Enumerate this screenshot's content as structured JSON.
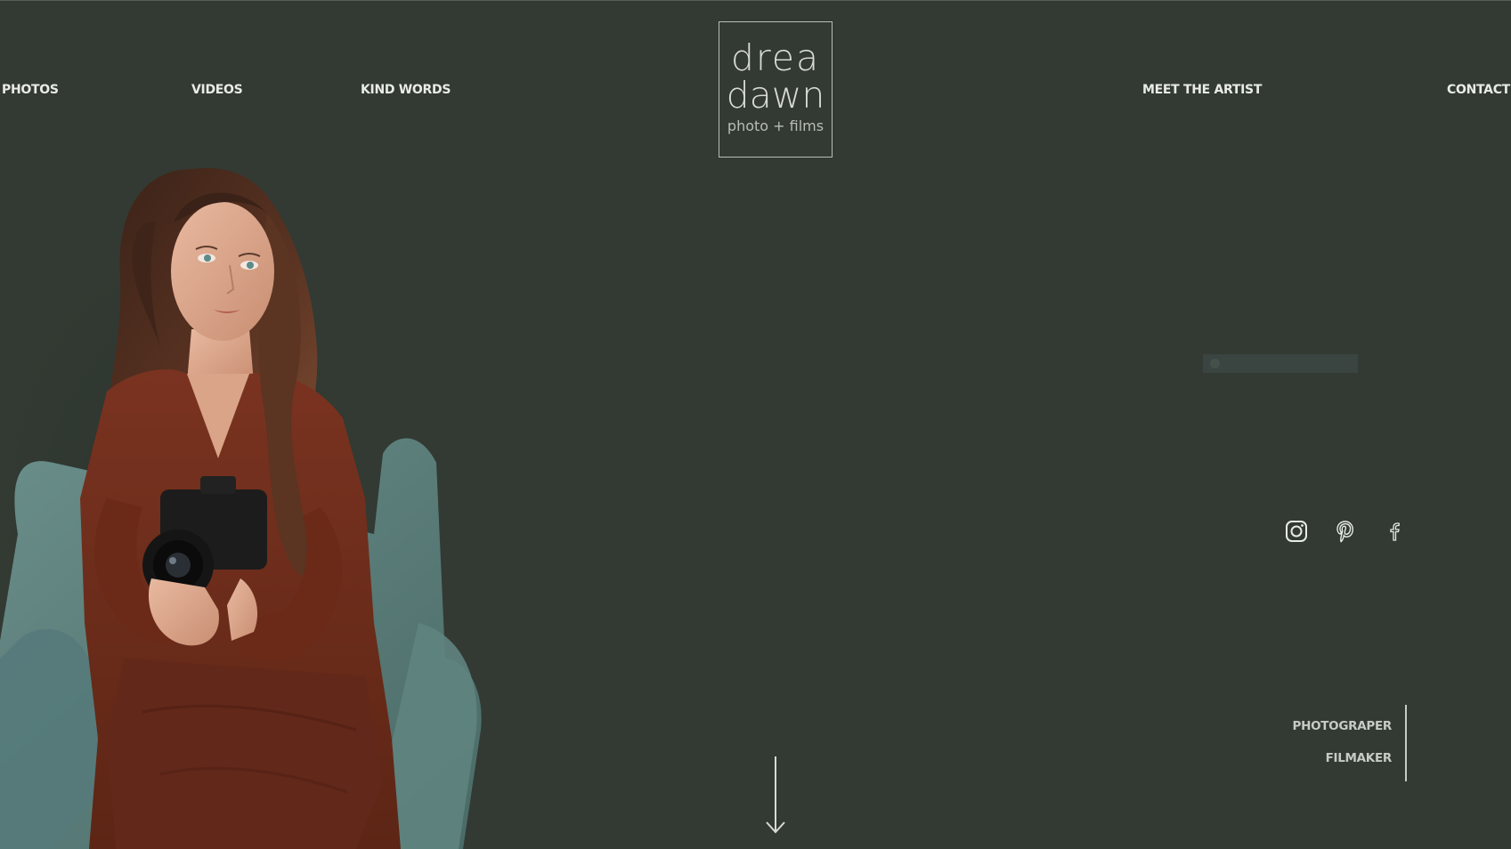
{
  "colors": {
    "background": "#323a33",
    "nav_text": "#e9ece6",
    "logo_line": "#b9bdb4",
    "dress": "#6b2a18",
    "chair": "#5b807c"
  },
  "nav": {
    "left": [
      {
        "label": "PHOTOS"
      },
      {
        "label": "VIDEOS"
      },
      {
        "label": "KIND WORDS"
      }
    ],
    "right": [
      {
        "label": "MEET THE ARTIST"
      },
      {
        "label": "CONTACT"
      }
    ]
  },
  "logo": {
    "line1": "drea",
    "line2": "dawn",
    "line3": "photo + films"
  },
  "hero": {
    "image": "portrait-woman-with-camera"
  },
  "social": [
    {
      "icon": "instagram-icon"
    },
    {
      "icon": "pinterest-icon"
    },
    {
      "icon": "facebook-icon"
    }
  ],
  "roles": [
    "PHOTOGRAPER",
    "FILMAKER"
  ],
  "scroll": {
    "icon": "arrow-down-icon"
  }
}
